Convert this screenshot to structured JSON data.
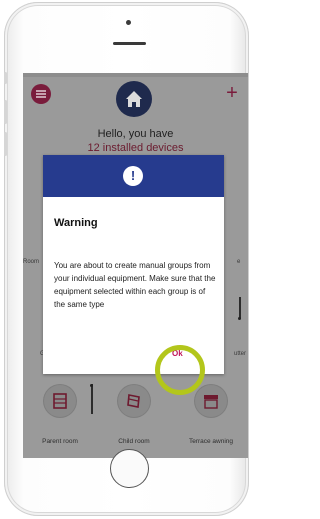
{
  "app": {
    "greeting_line1": "Hello, you have",
    "greeting_line2": "12 installed devices",
    "side_labels": [
      "Room",
      "e",
      "G",
      "utter"
    ],
    "devices": [
      {
        "label": "Parent room",
        "icon": "window-icon"
      },
      {
        "label": "Child room",
        "icon": "shutter-icon"
      },
      {
        "label": "Terrace awning",
        "icon": "awning-icon"
      }
    ]
  },
  "dialog": {
    "title": "Warning",
    "message": "You are about to create manual groups from your individual equipment. Make sure that the equipment selected within each group is of the same type",
    "ok_label": "Ok",
    "alert_glyph": "!"
  },
  "colors": {
    "header_blue": "#263b8e",
    "accent_red": "#c0135a",
    "highlight_ring": "#b3c61b"
  }
}
